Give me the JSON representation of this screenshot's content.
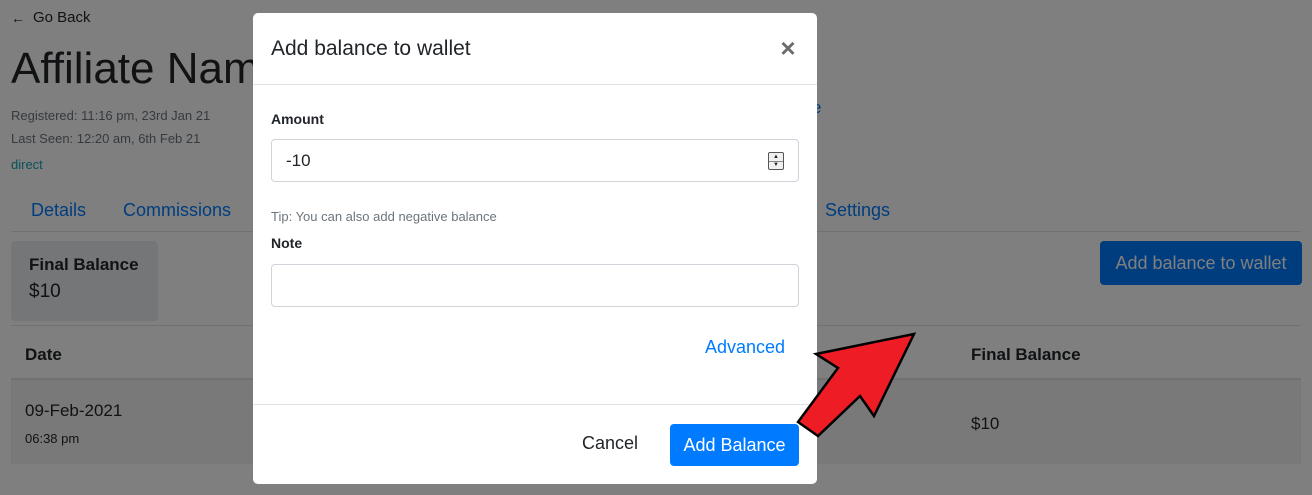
{
  "page": {
    "go_back": "Go Back",
    "title": "Affiliate Nam",
    "registered": "Registered: 11:16 pm, 23rd Jan 21",
    "last_seen": "Last Seen: 12:20 am, 6th Feb 21",
    "source": "direct",
    "partial_link": "e",
    "tabs": [
      {
        "label": "Details"
      },
      {
        "label": "Commissions"
      },
      {
        "label": "Settings"
      }
    ],
    "balance_card": {
      "label": "Final Balance",
      "value": "$10"
    },
    "add_wallet_button": "Add balance to wallet",
    "table": {
      "columns": [
        "Date",
        "Final Balance"
      ],
      "rows": [
        {
          "date": "09-Feb-2021",
          "time": "06:38 pm",
          "final_balance": "$10"
        }
      ]
    }
  },
  "modal": {
    "title": "Add balance to wallet",
    "close_symbol": "×",
    "amount_label": "Amount",
    "amount_value": "-10",
    "tip": "Tip: You can also add negative balance",
    "note_label": "Note",
    "note_value": "",
    "advanced_link": "Advanced",
    "cancel_button": "Cancel",
    "submit_button": "Add Balance"
  },
  "colors": {
    "primary": "#007bff",
    "overlay": "rgba(0,0,0,0.5)",
    "annotation_arrow": "#ee1c25"
  },
  "icons": {
    "back": "arrow-left-icon",
    "close": "close-icon",
    "spinner": "number-spinner-icon",
    "annotation": "red-arrow-annotation-icon"
  }
}
